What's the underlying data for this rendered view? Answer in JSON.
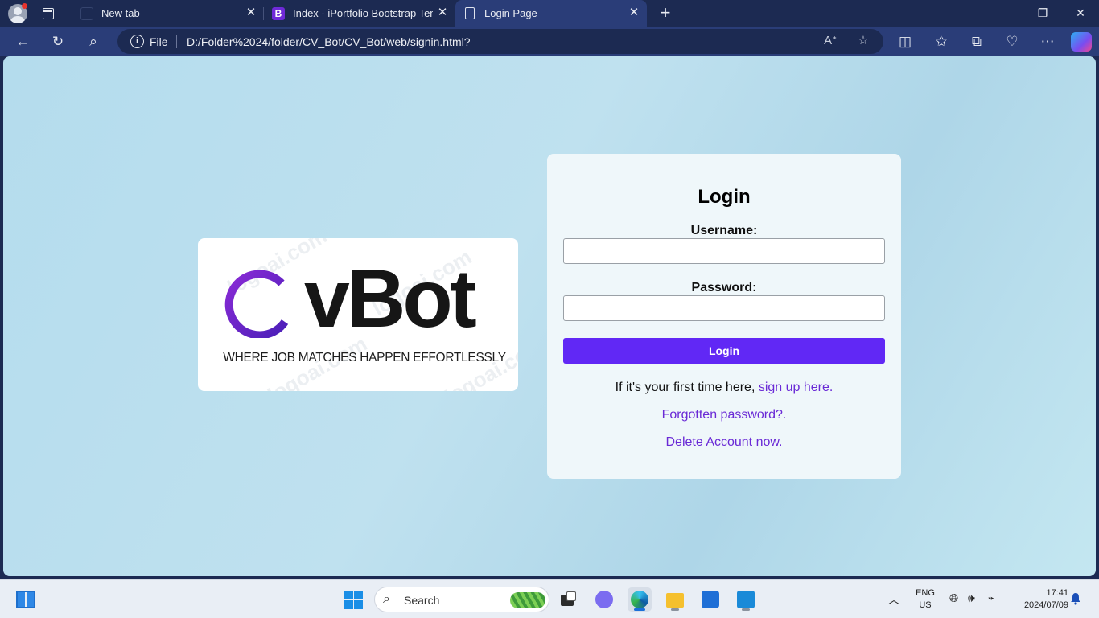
{
  "browser": {
    "tabs": [
      {
        "title": "New tab"
      },
      {
        "title": "Index - iPortfolio Bootstrap Template",
        "favicon_letter": "B"
      },
      {
        "title": "Login Page"
      }
    ],
    "address": {
      "scheme": "File",
      "url": "D:/Folder%2024/folder/CV_Bot/CV_Bot/web/signin.html?"
    }
  },
  "logo": {
    "word": "vBot",
    "tagline": "WHERE JOB MATCHES HAPPEN EFFORTLESSLY",
    "watermark": "logoai.com",
    "colors": {
      "ring_start": "#4b1fb8",
      "ring_end": "#8a2bd6"
    }
  },
  "login": {
    "title": "Login",
    "username_label": "Username:",
    "username_value": "",
    "password_label": "Password:",
    "password_value": "",
    "button_label": "Login",
    "first_time_prefix": "If it's your first time here, ",
    "signup_link": "sign up here",
    "signup_suffix": ".",
    "forgot_link": "Forgotten password?",
    "forgot_suffix": ".",
    "delete_link": "Delete Account now",
    "delete_suffix": ".",
    "colors": {
      "button": "#6128f5",
      "link": "#6a2ad6"
    }
  },
  "taskbar": {
    "search_placeholder": "Search",
    "language": "ENG",
    "region": "US",
    "time": "17:41",
    "date": "2024/07/09"
  }
}
